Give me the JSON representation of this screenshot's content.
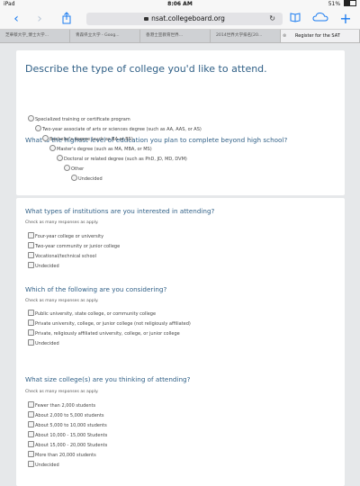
{
  "status": {
    "device": "iPad",
    "time": "8:06 AM",
    "battery": "51%"
  },
  "browser": {
    "url": "nsat.collegeboard.org",
    "tabs": [
      "芝華蔡大学_博士大学...",
      "青森県立大学 - Goog...",
      "香港士宣教育世界...",
      "2014世界大学排名[20...",
      "Register for the SAT"
    ]
  },
  "page": {
    "title": "Describe the type of college you'd like to attend."
  },
  "q1": {
    "title": "What is the highest level of education you plan to complete beyond high school?",
    "options": [
      "Specialized training or certificate program",
      "Two-year associate of arts or sciences degree (such as AA, AAS, or AS)",
      "Bachelor's degree (such as BA or BS)",
      "Master's degree (such as MA, MBA, or MS)",
      "Doctoral or related degree (such as PhD, JD, MD, DVM)",
      "Other",
      "Undecided"
    ]
  },
  "q2": {
    "title": "What types of institutions are you interested in attending?",
    "hint": "Check as many responses as apply.",
    "options": [
      "Four-year college or university",
      "Two-year community or junior college",
      "Vocational/technical school",
      "Undecided"
    ]
  },
  "q3": {
    "title": "Which of the following are you considering?",
    "hint": "Check as many responses as apply.",
    "options": [
      "Public university, state college, or community college",
      "Private university, college, or junior college (not religiously affiliated)",
      "Private, religiously affiliated university, college, or junior college",
      "Undecided"
    ]
  },
  "q4": {
    "title": "What size college(s) are you thinking of attending?",
    "hint": "Check as many responses as apply.",
    "options": [
      "Fewer than 2,000 students",
      "About 2,000 to 5,000 students",
      "About 5,000 to 10,000 students",
      "About 10,000 - 15,000 Students",
      "About 15,000 - 20,000 Students",
      "More than 20,000 students",
      "Undecided"
    ]
  }
}
